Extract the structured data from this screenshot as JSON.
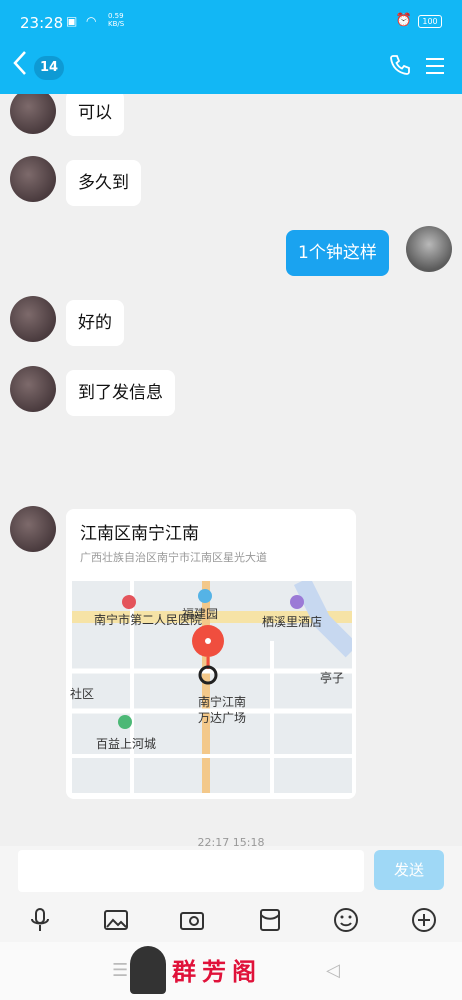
{
  "status_bar": {
    "time": "23:28",
    "net_speed": "0.59",
    "net_unit": "KB/S",
    "battery": "100"
  },
  "nav": {
    "back_glyph": "‹",
    "unread_count": "14"
  },
  "messages": [
    {
      "from": "other",
      "text": "可以"
    },
    {
      "from": "other",
      "text": "多久到"
    },
    {
      "from": "me",
      "text": "1个钟这样"
    },
    {
      "from": "other",
      "text": "好的"
    },
    {
      "from": "other",
      "text": "到了发信息"
    }
  ],
  "location": {
    "title": "江南区南宁江南",
    "address": "广西壮族自治区南宁市江南区星光大道",
    "map_labels": {
      "hospital": "南宁市第二人民医院",
      "fujian": "福建园",
      "hotel": "栖溪里酒店",
      "community": "社区",
      "tingzi": "亭子",
      "wanda_line1": "南宁江南",
      "wanda_line2": "万达广场",
      "baiyi": "百益上河城"
    }
  },
  "timestamp": "22:17 15:18",
  "input": {
    "placeholder": "",
    "send_label": "发送"
  },
  "toolbar_icons": [
    "mic-icon",
    "image-icon",
    "camera-icon",
    "red-packet-icon",
    "emoji-icon",
    "plus-icon"
  ],
  "watermark": "群芳阁",
  "colors": {
    "accent": "#12b7f5",
    "my_bubble": "#1aa3f0",
    "send_disabled": "#9fd8f6",
    "pin": "#f04e3e"
  }
}
